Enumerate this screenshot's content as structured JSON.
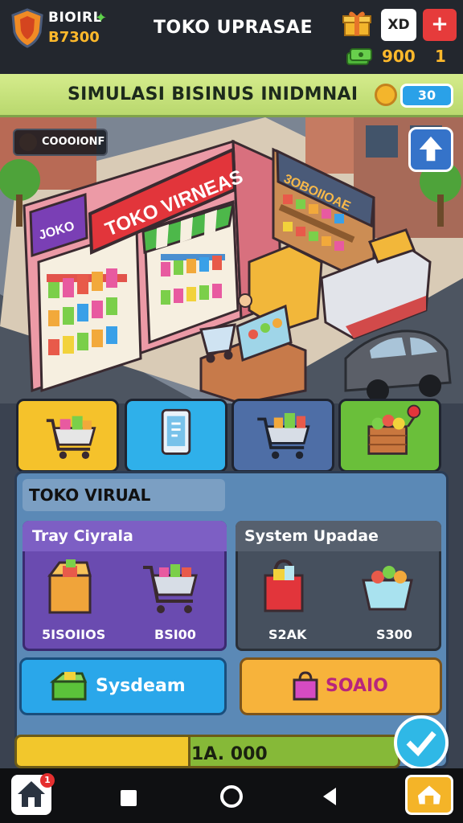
{
  "header": {
    "player_name": "BIOIRL",
    "player_money": "B7300",
    "title": "TOKO UPRASAE",
    "x_button": "XD",
    "plus_button": "+",
    "gems": "900",
    "level": "1"
  },
  "banner": {
    "text": "SIMULASI BISINUS INIDMNAI",
    "badge": "30"
  },
  "scene": {
    "location_label": "COOOIONF",
    "shop_sign": "TOKO VIRNEAS",
    "side_sign": "JOKO",
    "market_sign": "3OBOIIOAE"
  },
  "panel": {
    "title": "TOKO VIRUAL",
    "card_a": {
      "title": "Tray Ciyrala",
      "prices": [
        "5ISOIIOS",
        "BSI00"
      ]
    },
    "card_b": {
      "title": "System Upadae",
      "prices": [
        "S2AK",
        "S300"
      ]
    },
    "button_left": "Sysdeam",
    "button_right": "SOAIO"
  },
  "progress": {
    "text": "1A. 000",
    "fraction": 0.45
  },
  "nav": {
    "home_badge": "1"
  },
  "colors": {
    "topbar": "#23272e",
    "banner": "#c7e27c",
    "panel": "#5b89b6",
    "card_purple": "#6a4bb0",
    "button_blue": "#2aa7ea",
    "button_orange": "#f7b33b",
    "progress_yellow": "#f2c72c",
    "progress_green": "#86b938"
  }
}
